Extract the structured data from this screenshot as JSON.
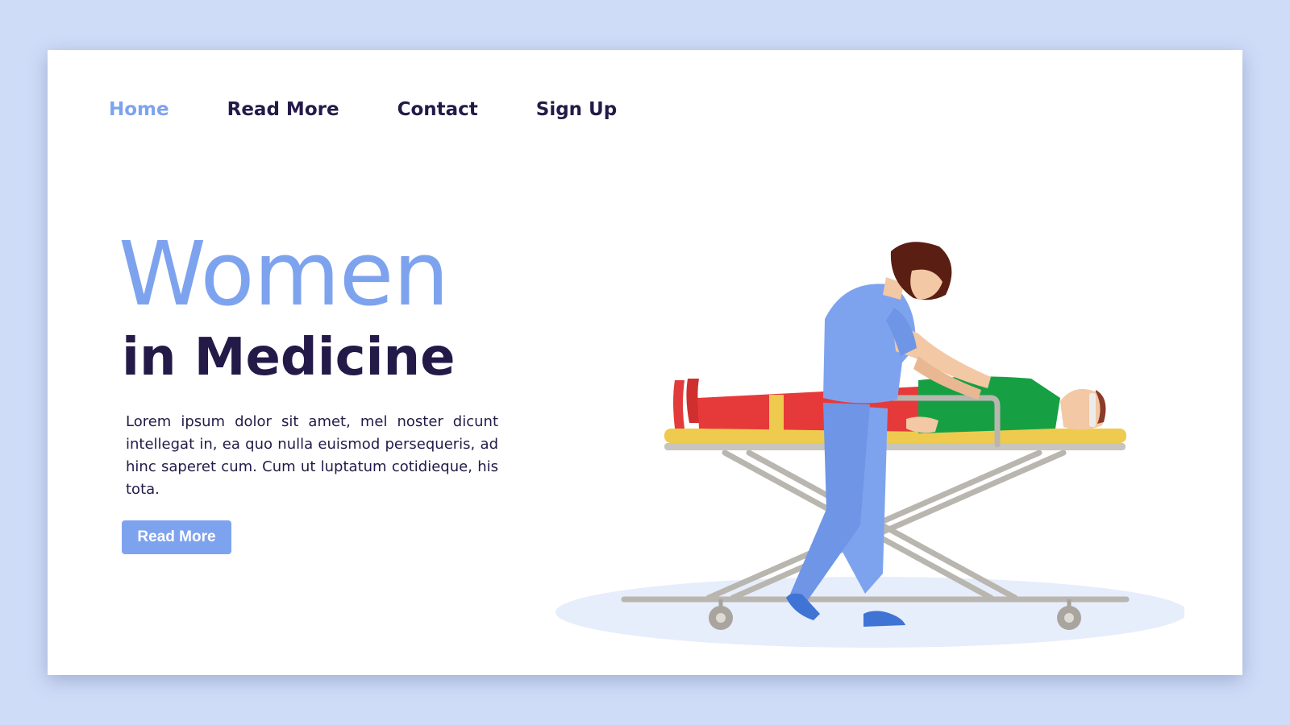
{
  "nav": {
    "items": [
      {
        "label": "Home",
        "active": true
      },
      {
        "label": "Read More",
        "active": false
      },
      {
        "label": "Contact",
        "active": false
      },
      {
        "label": "Sign Up",
        "active": false
      }
    ]
  },
  "hero": {
    "title_line1": "Women",
    "title_line2": "in Medicine",
    "body": "Lorem ipsum dolor sit amet, mel noster dicunt intellegat in, ea quo nulla euismod persequeris, ad hinc saperet cum. Cum ut luptatum cotidieque, his tota.",
    "cta_label": "Read More"
  },
  "illustration": {
    "subject": "nurse pushing patient on stretcher"
  },
  "colors": {
    "background": "#cfdcf8",
    "accent": "#7ea3ee",
    "text_dark": "#241a48",
    "page": "#ffffff"
  }
}
